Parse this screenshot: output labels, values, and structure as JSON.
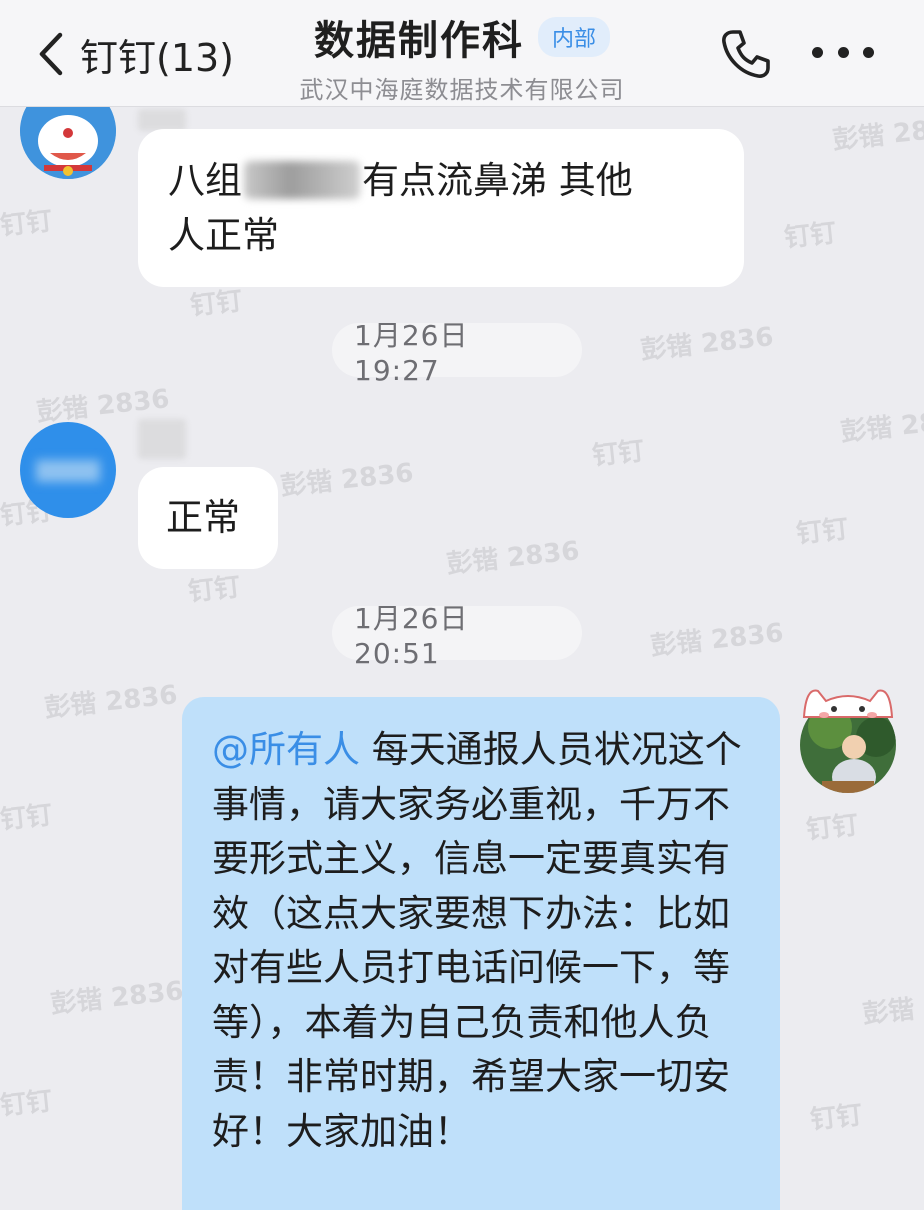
{
  "header": {
    "back_label": "钉钉(13)",
    "title": "数据制作科",
    "badge": "内部",
    "subtitle": "武汉中海庭数据技术有限公司"
  },
  "messages": [
    {
      "sender": "incoming",
      "text_before": "八组",
      "text_after": "有点流鼻涕  其他",
      "text_line2": "人正常"
    },
    {
      "sender": "incoming",
      "text": "正常"
    },
    {
      "sender": "outgoing",
      "mention": "@所有人",
      "text": "每天通报人员状况这个事情，请大家务必重视，千万不要形式主义，信息一定要真实有效（这点大家要想下办法：比如对有些人员打电话问候一下，等等），本着为自己负责和他人负责！非常时期，希望大家一切安好！大家加油！"
    }
  ],
  "timestamps": [
    "1月26日 19:27",
    "1月26日 20:51"
  ],
  "watermarks": [
    "钉钉",
    "彭锴 2836"
  ],
  "icons": [
    "back-chevron-icon",
    "phone-icon",
    "more-icon"
  ],
  "colors": {
    "background": "#ececf0",
    "outgoing_bubble": "#bfe0fa",
    "mention": "#3a8ee6",
    "badge_bg": "#e1edfb"
  }
}
